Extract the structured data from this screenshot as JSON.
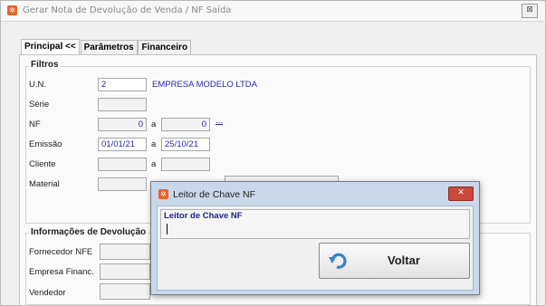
{
  "window": {
    "title": "Gerar Nota de Devolução de Venda / NF Saída",
    "close_glyph": "⊠"
  },
  "tabs": [
    {
      "label": "Principal <<"
    },
    {
      "label": "Parâmetros"
    },
    {
      "label": "Financeiro"
    }
  ],
  "filtros": {
    "title": "Filtros",
    "un_label": "U.N.",
    "un_value": "2",
    "un_company": "EMPRESA MODELO LTDA",
    "serie_label": "Série",
    "serie_value": "",
    "nf_label": "NF",
    "nf_from": "0",
    "nf_sep": "a",
    "nf_to": "0",
    "nf_more": "...",
    "emissao_label": "Emissão",
    "emissao_from": "01/01/21",
    "emissao_sep": "a",
    "emissao_to": "25/10/21",
    "cliente_label": "Cliente",
    "cliente_from": "",
    "cliente_sep": "a",
    "cliente_to": "",
    "material_label": "Material"
  },
  "devolucao": {
    "title": "Informações de Devolução",
    "fornecedor_label": "Fornecedor NFE",
    "empresa_label": "Empresa Financ.",
    "vendedor_label": "Vendedor"
  },
  "dialog": {
    "title": "Leitor de Chave NF",
    "group_title": "Leitor de Chave NF",
    "close_glyph": "✕",
    "voltar_label": "Voltar"
  },
  "icons": {
    "app": "app-logo-icon",
    "undo": "undo-arrow-icon"
  }
}
